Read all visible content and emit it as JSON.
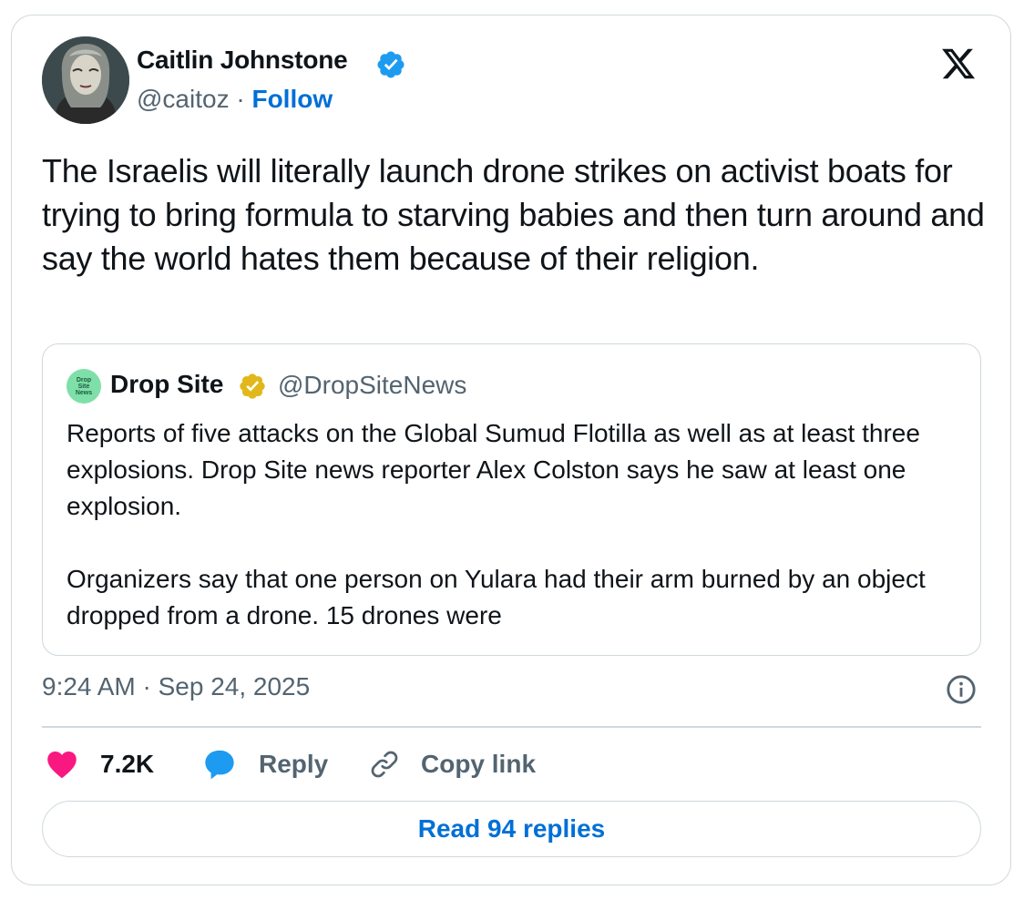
{
  "author": {
    "name": "Caitlin Johnstone",
    "handle": "@caitoz",
    "separator": "·",
    "follow_label": "Follow"
  },
  "tweet": {
    "text": "The Israelis will literally launch drone strikes on activist boats for trying to bring formula to starving babies and then turn around and say the world hates them because of their religion."
  },
  "quote": {
    "avatar_text": "Drop Site News",
    "name": "Drop Site",
    "handle": "@DropSiteNews",
    "paragraph_1": "Reports of five attacks on the Global Sumud Flotilla as well as at least three explosions. Drop Site news reporter Alex Colston says he saw at least one explosion.",
    "paragraph_2": "Organizers say that one person on Yulara had their arm burned by an object dropped from a drone. 15 drones were"
  },
  "meta": {
    "timestamp": "9:24 AM · Sep 24, 2025"
  },
  "actions": {
    "like_count": "7.2K",
    "reply_label": "Reply",
    "copy_link_label": "Copy link"
  },
  "footer": {
    "read_replies_label": "Read 94 replies"
  },
  "colors": {
    "link_blue": "#006fd6",
    "verified_blue": "#1d9bf0",
    "verified_gold": "#e2b719",
    "like_pink": "#f91880",
    "reply_blue": "#1d9bf0",
    "muted_text": "#536471",
    "border": "#cfd9de"
  },
  "icons": {
    "verified_badge": "verified-badge-icon",
    "business_badge": "gold-verified-badge-icon",
    "x_logo": "x-logo-icon",
    "info": "info-icon",
    "heart": "heart-icon",
    "reply": "reply-bubble-icon",
    "link": "link-icon"
  }
}
